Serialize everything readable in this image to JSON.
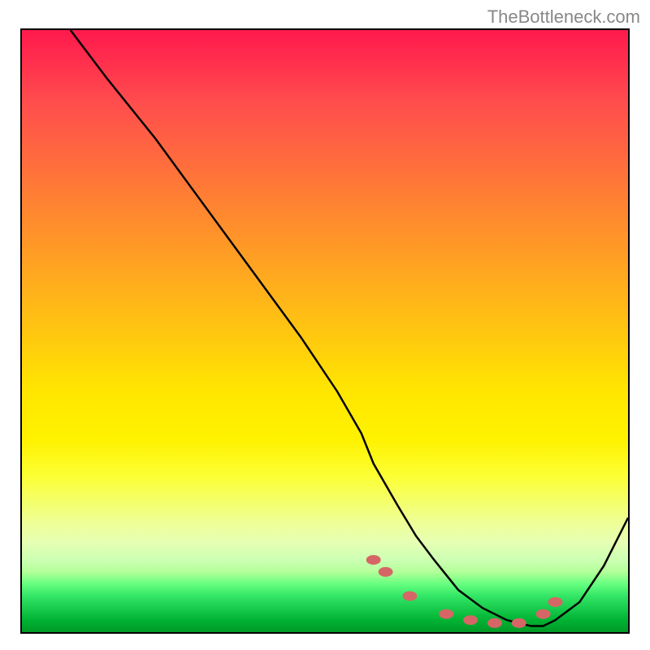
{
  "watermark": "TheBottleneck.com",
  "chart_data": {
    "type": "line",
    "title": "",
    "xlabel": "",
    "ylabel": "",
    "xlim": [
      0,
      100
    ],
    "ylim": [
      0,
      100
    ],
    "series": [
      {
        "name": "bottleneck-curve",
        "x": [
          8,
          14,
          22,
          30,
          38,
          46,
          52,
          56,
          58,
          62,
          65,
          68,
          72,
          76,
          80,
          84,
          86,
          88,
          92,
          96,
          100
        ],
        "y": [
          100,
          92,
          82,
          71,
          60,
          49,
          40,
          33,
          28,
          21,
          16,
          12,
          7,
          4,
          2,
          1,
          1,
          2,
          5,
          11,
          19
        ]
      }
    ],
    "markers": [
      {
        "x": 58,
        "y": 12,
        "color": "#d66666"
      },
      {
        "x": 60,
        "y": 10,
        "color": "#d66666"
      },
      {
        "x": 64,
        "y": 6,
        "color": "#d66666"
      },
      {
        "x": 70,
        "y": 3,
        "color": "#d66666"
      },
      {
        "x": 74,
        "y": 2,
        "color": "#d66666"
      },
      {
        "x": 78,
        "y": 1.5,
        "color": "#d66666"
      },
      {
        "x": 82,
        "y": 1.5,
        "color": "#d66666"
      },
      {
        "x": 86,
        "y": 3,
        "color": "#d66666"
      },
      {
        "x": 88,
        "y": 5,
        "color": "#d66666"
      }
    ],
    "gradient_colors": {
      "top": "#ff1a4d",
      "bottom": "#009926"
    }
  }
}
